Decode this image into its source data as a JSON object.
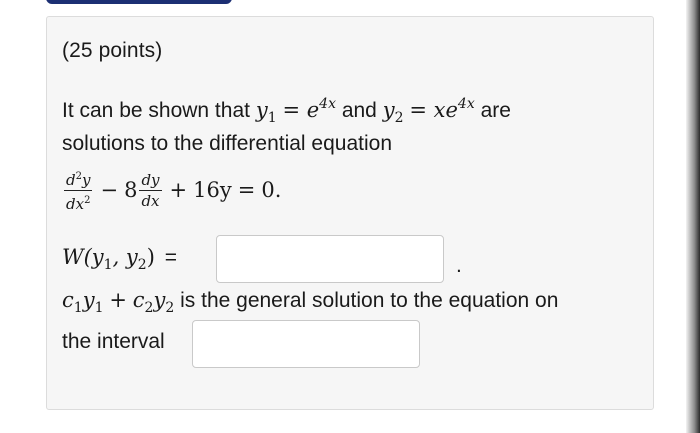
{
  "header": {
    "points": "(25 points)"
  },
  "problem": {
    "intro": "It can be shown that",
    "y1": "y",
    "y1_sub": "1",
    "y1_rhs_base": "e",
    "y1_rhs_exp": "4x",
    "and": "and",
    "y2": "y",
    "y2_sub": "2",
    "y2_rhs_base": "xe",
    "y2_rhs_exp": "4x",
    "are": "are",
    "line2": "solutions to the differential equation",
    "eq": {
      "d2y": "d",
      "d2y_exp": "2",
      "d2y_var": "y",
      "dx2": "dx",
      "dx2_exp": "2",
      "minus": "−",
      "coef8": "8",
      "dy": "dy",
      "dx": "dx",
      "plus": "+",
      "term": "16y",
      "equals": "=",
      "rhs": "0."
    }
  },
  "wronskian": {
    "label": "W",
    "args": "(y",
    "sub1": "1",
    "comma": ", y",
    "sub2": "2",
    "close": ")",
    "equals": "=",
    "trailing": ".",
    "value": ""
  },
  "general": {
    "c1": "c",
    "c1_sub": "1",
    "y1": "y",
    "y1_sub": "1",
    "plus": "+",
    "c2": "c",
    "c2_sub": "2",
    "y2": "y",
    "y2_sub": "2",
    "text": "is the general solution to the equation on",
    "line2": "the interval",
    "value": ""
  }
}
